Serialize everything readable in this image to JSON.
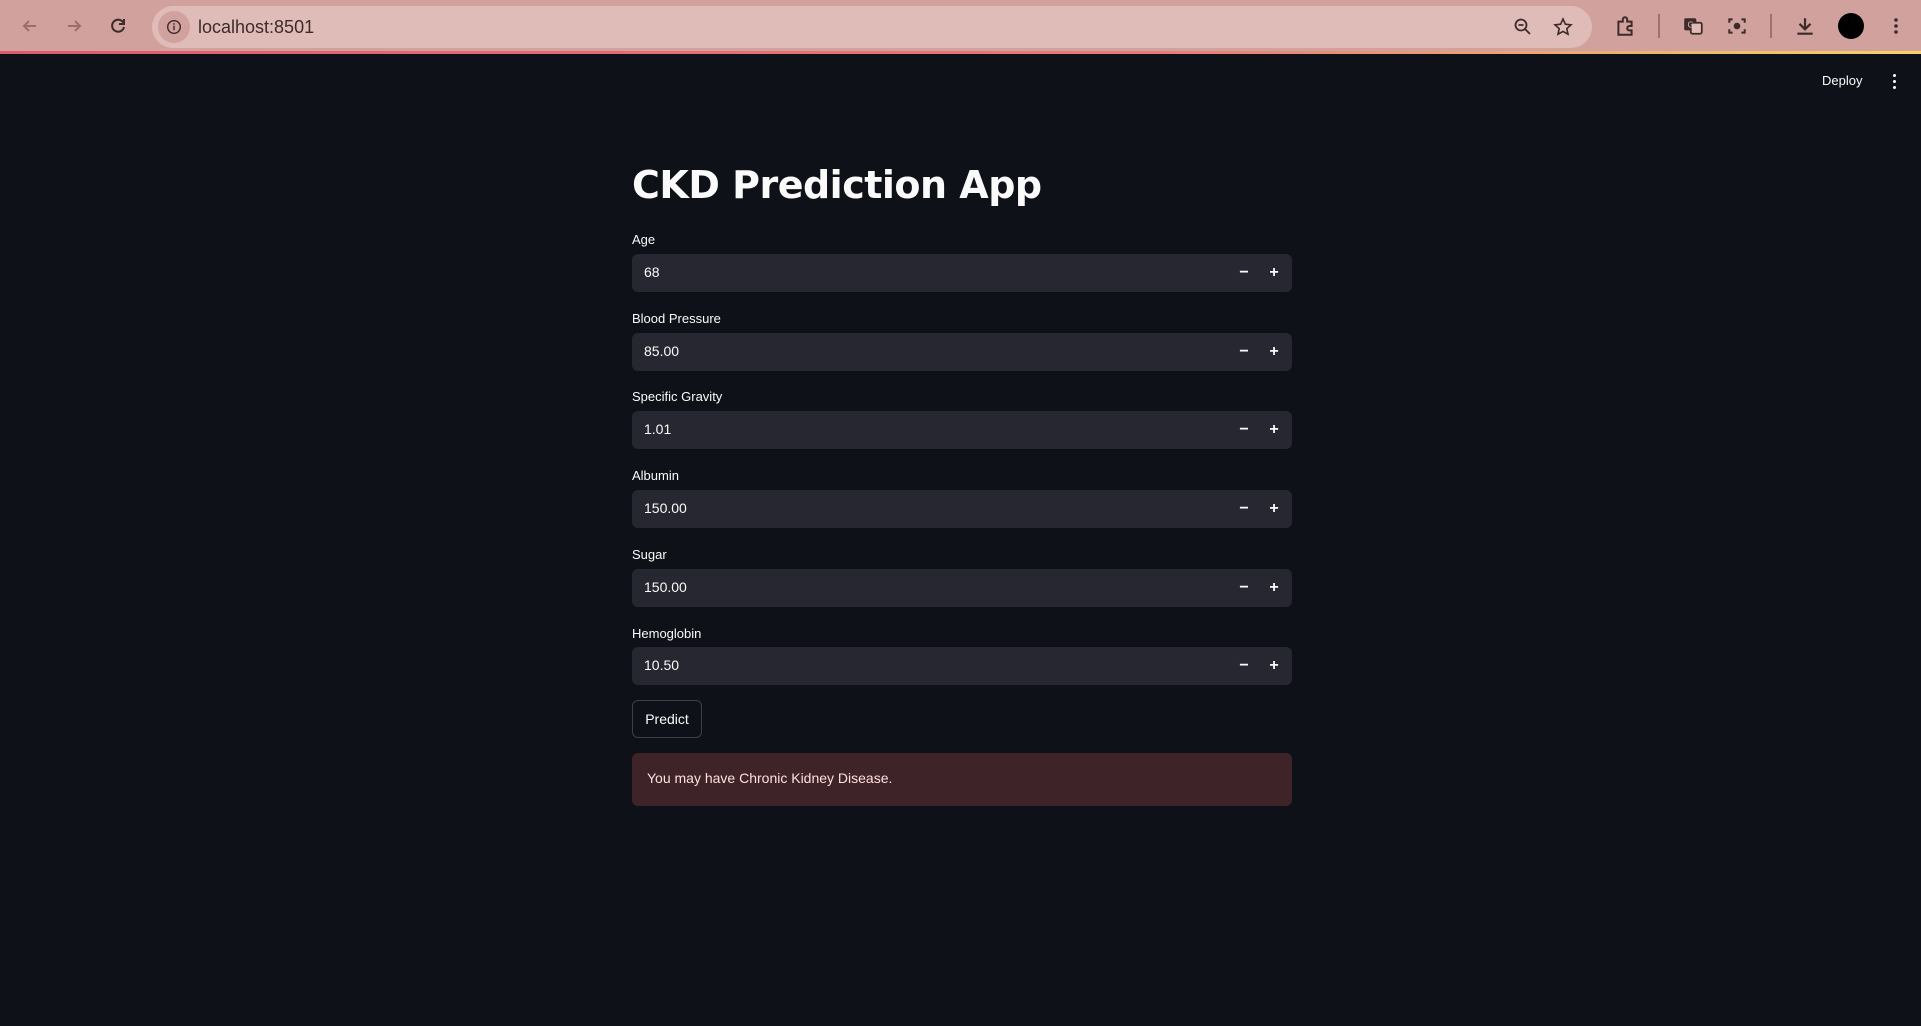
{
  "browser": {
    "url": "localhost:8501",
    "icons": [
      "back-arrow-icon",
      "forward-arrow-icon",
      "reload-icon",
      "site-info-icon",
      "zoom-icon",
      "bookmark-star-icon",
      "extensions-icon",
      "translate-icon",
      "screenshot-icon",
      "download-icon",
      "profile-avatar",
      "chrome-menu-icon"
    ]
  },
  "header": {
    "deploy_label": "Deploy"
  },
  "main": {
    "title": "CKD Prediction App",
    "fields": [
      {
        "label": "Age",
        "value": "68"
      },
      {
        "label": "Blood Pressure",
        "value": "85.00"
      },
      {
        "label": "Specific Gravity",
        "value": "1.01"
      },
      {
        "label": "Albumin",
        "value": "150.00"
      },
      {
        "label": "Sugar",
        "value": "150.00"
      },
      {
        "label": "Hemoglobin",
        "value": "10.50"
      }
    ],
    "stepper_minus": "−",
    "stepper_plus": "+",
    "predict_label": "Predict",
    "result_message": "You may have Chronic Kidney Disease."
  },
  "colors": {
    "background": "#0e1117",
    "input_bg": "#262730",
    "error_bg": "#3e2428",
    "chrome_bg": "#d1a19d"
  }
}
